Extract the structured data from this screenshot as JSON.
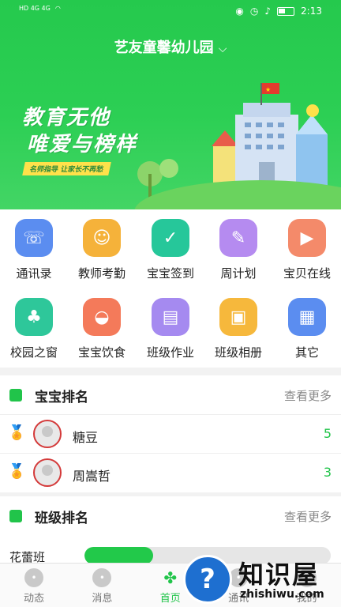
{
  "status_bar": {
    "time": "2:13",
    "left_text": "HD 4G 4G"
  },
  "header": {
    "title": "艺友童馨幼儿园"
  },
  "banner": {
    "line1": "教育无他",
    "line2": "唯爱与榜样",
    "tag": "名师指导 让家长不再愁"
  },
  "grid": {
    "items": [
      {
        "label": "通讯录",
        "icon": "contacts-icon",
        "color": "#5b8df0",
        "glyph": "☏"
      },
      {
        "label": "教师考勤",
        "icon": "teacher-attendance-icon",
        "color": "#f5b23a",
        "glyph": "☺"
      },
      {
        "label": "宝宝签到",
        "icon": "baby-checkin-icon",
        "color": "#26c79a",
        "glyph": "✓"
      },
      {
        "label": "周计划",
        "icon": "weekly-plan-icon",
        "color": "#b58bf0",
        "glyph": "✎"
      },
      {
        "label": "宝贝在线",
        "icon": "baby-online-icon",
        "color": "#f48a6a",
        "glyph": "▶"
      },
      {
        "label": "校园之窗",
        "icon": "campus-window-icon",
        "color": "#2ec79a",
        "glyph": "♣"
      },
      {
        "label": "宝宝饮食",
        "icon": "baby-meal-icon",
        "color": "#f47a5a",
        "glyph": "◒"
      },
      {
        "label": "班级作业",
        "icon": "class-homework-icon",
        "color": "#a58af0",
        "glyph": "▤"
      },
      {
        "label": "班级相册",
        "icon": "class-album-icon",
        "color": "#f6b83c",
        "glyph": "▣"
      },
      {
        "label": "其它",
        "icon": "other-icon",
        "color": "#5b8df0",
        "glyph": "▦"
      }
    ]
  },
  "baby_rank": {
    "title": "宝宝排名",
    "more": "查看更多",
    "rows": [
      {
        "name": "糖豆",
        "score": "5",
        "medal": "gold-medal-icon"
      },
      {
        "name": "周嵩哲",
        "score": "3",
        "medal": "silver-medal-icon"
      }
    ]
  },
  "class_rank": {
    "title": "班级排名",
    "more": "查看更多",
    "rows": [
      {
        "name": "花蕾班",
        "progress": 0.28
      }
    ]
  },
  "nav": {
    "items": [
      {
        "label": "动态",
        "icon": "moments-icon"
      },
      {
        "label": "消息",
        "icon": "message-icon"
      },
      {
        "label": "首页",
        "icon": "home-clover-icon"
      },
      {
        "label": "通讯",
        "icon": "contacts-nav-icon"
      },
      {
        "label": "我的",
        "icon": "profile-icon"
      }
    ]
  },
  "watermark": {
    "text1": "知识屋",
    "text2": "zhishiwu.com",
    "reg": "®"
  }
}
